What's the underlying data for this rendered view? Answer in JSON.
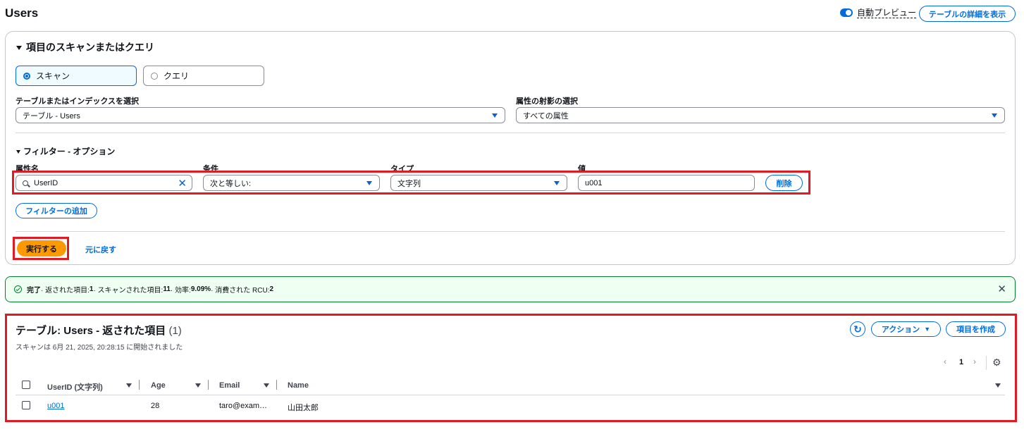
{
  "header": {
    "title": "Users",
    "auto_preview_label": "自動プレビュー",
    "table_details_button": "テーブルの詳細を表示"
  },
  "scan_panel": {
    "heading": "項目のスキャンまたはクエリ",
    "mode_options": [
      "スキャン",
      "クエリ"
    ],
    "selected_mode": "スキャン",
    "table_select_label": "テーブルまたはインデックスを選択",
    "table_select_value": "テーブル - Users",
    "projection_label": "属性の射影の選択",
    "projection_value": "すべての属性",
    "filter_heading": "フィルター - オプション",
    "filter": {
      "attr_label": "属性名",
      "cond_label": "条件",
      "type_label": "タイプ",
      "value_label": "値",
      "attr_value": "UserID",
      "cond_value": "次と等しい:",
      "type_value": "文字列",
      "value_value": "u001",
      "delete_button": "削除"
    },
    "add_filter_button": "フィルターの追加",
    "run_button": "実行する",
    "reset_link": "元に戻す"
  },
  "alert": {
    "status": "完了",
    "text_1": " · 返された項目: ",
    "returned": "1",
    "text_2": " · スキャンされた項目: ",
    "scanned": "11",
    "text_3": " · 効率: ",
    "efficiency": "9.09%",
    "text_4": " · 消費された RCU: ",
    "rcu": "2"
  },
  "results": {
    "title": "テーブル: Users - 返された項目",
    "count": "(1)",
    "subtitle": "スキャンは 6月 21, 2025, 20:28:15 に開始されました",
    "actions_button": "アクション",
    "create_button": "項目を作成",
    "page": "1",
    "columns": [
      "UserID (文字列)",
      "Age",
      "Email",
      "Name"
    ],
    "rows": [
      {
        "userid": "u001",
        "age": "28",
        "email": "taro@exam…",
        "name": "山田太郎"
      }
    ]
  },
  "colors": {
    "accent": "#006ce0",
    "run": "#ff9900",
    "highlight": "#e01b24",
    "success": "#00802f"
  }
}
